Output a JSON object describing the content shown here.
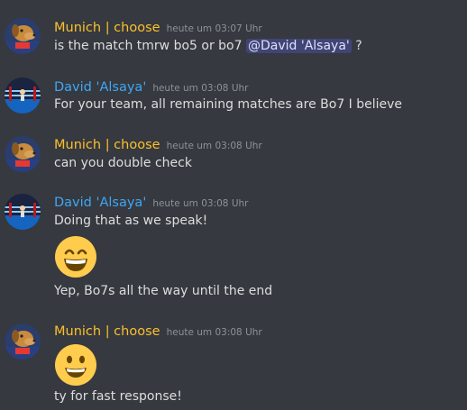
{
  "colors": {
    "munich": "#fbc02d",
    "david": "#3fa7f5",
    "background": "#36393f",
    "text": "#dcddde",
    "timestamp": "#8e9297"
  },
  "messages": [
    {
      "author": "Munich | choose",
      "author_color": "#fbc02d",
      "avatar": "dog-avatar",
      "timestamp": "heute um 03:07 Uhr",
      "text_before": "is the match tmrw bo5 or bo7 ",
      "mention": "@David 'Alsaya'",
      "text_after": " ?"
    },
    {
      "author": "David 'Alsaya'",
      "author_color": "#3fa7f5",
      "avatar": "boxing-ring-avatar",
      "timestamp": "heute um 03:08 Uhr",
      "text": "For your team, all remaining matches are Bo7 I believe"
    },
    {
      "author": "Munich | choose",
      "author_color": "#fbc02d",
      "avatar": "dog-avatar",
      "timestamp": "heute um 03:08 Uhr",
      "text": "can you double check"
    },
    {
      "author": "David 'Alsaya'",
      "author_color": "#3fa7f5",
      "avatar": "boxing-ring-avatar",
      "timestamp": "heute um 03:08 Uhr",
      "text": "Doing that as we speak!",
      "emoji": "grinning-smile-emoji",
      "text2": "Yep, Bo7s all the way until the end"
    },
    {
      "author": "Munich | choose",
      "author_color": "#fbc02d",
      "avatar": "dog-avatar",
      "timestamp": "heute um 03:08 Uhr",
      "emoji": "smiling-emoji",
      "text2": "ty for fast response!"
    }
  ]
}
